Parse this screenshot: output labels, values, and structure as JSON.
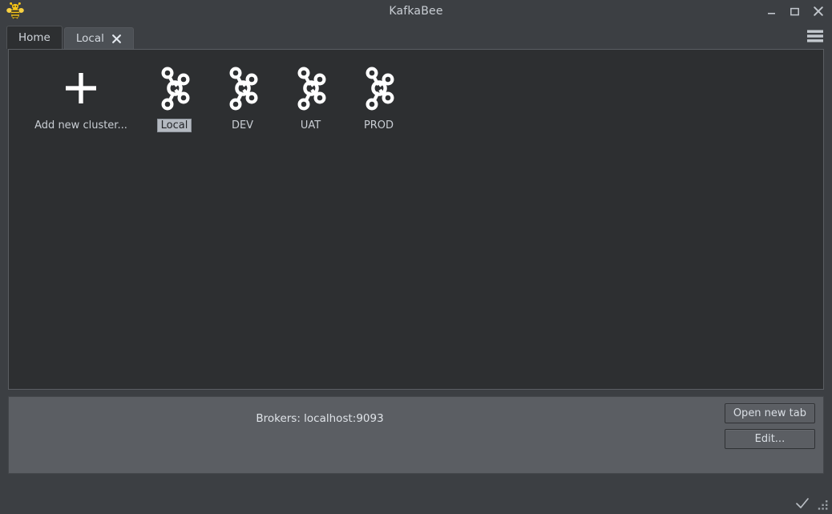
{
  "window": {
    "title": "KafkaBee",
    "logo_icon": "bee-icon",
    "controls": [
      {
        "name": "minimize-button",
        "icon": "minimize-icon",
        "label": "–"
      },
      {
        "name": "maximize-button",
        "icon": "maximize-icon",
        "label": "□"
      },
      {
        "name": "close-button",
        "icon": "close-icon",
        "label": "✕"
      }
    ]
  },
  "tabs": {
    "items": [
      {
        "label": "Home",
        "active": true,
        "closable": false
      },
      {
        "label": "Local",
        "active": false,
        "closable": true,
        "close_icon": "close-icon"
      }
    ],
    "menu_icon": "hamburger-menu-icon"
  },
  "clusters": {
    "items": [
      {
        "label": "Add new cluster...",
        "icon": "plus-icon",
        "selected": false
      },
      {
        "label": "Local",
        "icon": "kafka-cluster-icon",
        "selected": true
      },
      {
        "label": "DEV",
        "icon": "kafka-cluster-icon",
        "selected": false
      },
      {
        "label": "UAT",
        "icon": "kafka-cluster-icon",
        "selected": false
      },
      {
        "label": "PROD",
        "icon": "kafka-cluster-icon",
        "selected": false
      }
    ]
  },
  "detail": {
    "brokers_label": "Brokers:",
    "brokers_value": "localhost:9093",
    "brokers_line": "Brokers:  localhost:9093",
    "open_new_tab_label": "Open new tab",
    "edit_label": "Edit..."
  },
  "statusbar": {
    "check_icon": "checkmark-icon",
    "grip_icon": "resize-grip-icon"
  },
  "colors": {
    "window_bg": "#3c3f43",
    "content_bg": "#2d2f31",
    "panel_bg": "#5b5e63",
    "text": "#c9ced4",
    "selection_bg": "#b4b9c0",
    "border": "#5b5e63",
    "bee_yellow": "#f5c518"
  }
}
